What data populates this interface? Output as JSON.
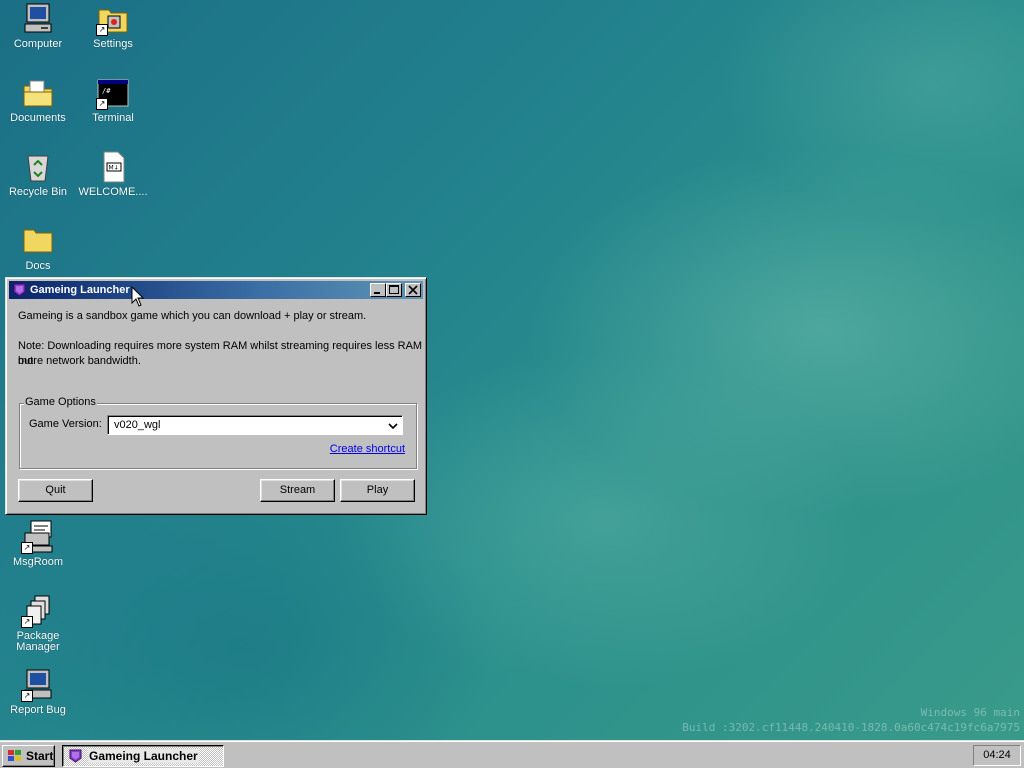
{
  "desktop": {
    "icons": [
      {
        "label": "Computer",
        "icon": "computer-icon"
      },
      {
        "label": "Settings",
        "icon": "settings-icon"
      },
      {
        "label": "Documents",
        "icon": "documents-folder-icon"
      },
      {
        "label": "Terminal",
        "icon": "terminal-icon"
      },
      {
        "label": "Recycle Bin",
        "icon": "recycle-bin-icon"
      },
      {
        "label": "WELCOME....",
        "icon": "markdown-file-icon"
      },
      {
        "label": "Docs",
        "icon": "folder-icon"
      },
      {
        "label": "MsgRoom",
        "icon": "msgroom-icon"
      },
      {
        "label": "Package Manager",
        "icon": "package-manager-icon"
      },
      {
        "label": "Report Bug",
        "icon": "report-bug-icon"
      }
    ],
    "watermark": {
      "line1": "Windows 96 main",
      "line2": "Build :3202.cf11448.240410-1828.0a60c474c19fc6a7975"
    }
  },
  "window": {
    "title": "Gameing Launcher",
    "description": "Gameing is a sandbox game which you can download + play or stream.",
    "note_line1": "Note: Downloading requires more system RAM whilst streaming requires less RAM but",
    "note_line2": "more network bandwidth.",
    "options": {
      "legend": "Game Options",
      "version_label": "Game Version:",
      "version_value": "v020_wgl",
      "shortcut_link": "Create shortcut"
    },
    "buttons": {
      "quit": "Quit",
      "stream": "Stream",
      "play": "Play"
    }
  },
  "taskbar": {
    "start_label": "Start",
    "task_label": "Gameing Launcher",
    "clock": "04:24"
  }
}
